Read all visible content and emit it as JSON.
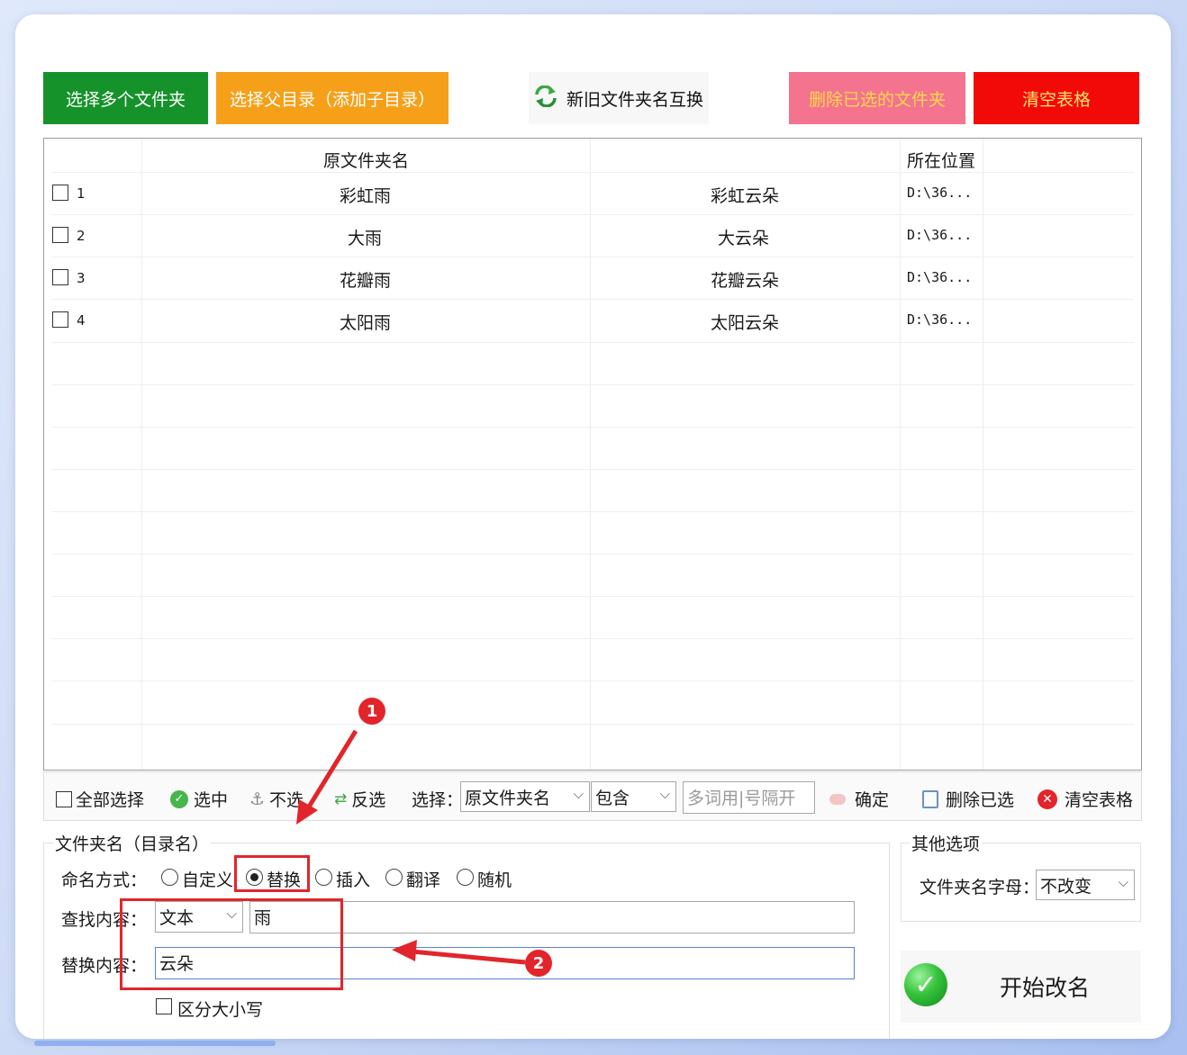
{
  "toolbar_top": {
    "select_multiple": "选择多个文件夹",
    "select_parent": "选择父目录（添加子目录）",
    "swap": "新旧文件夹名互换",
    "delete_selected": "删除已选的文件夹",
    "clear_table": "清空表格"
  },
  "table": {
    "headers": [
      "原文件夹名",
      "所在位置"
    ],
    "rows": [
      {
        "index": "1",
        "original": "彩虹雨",
        "new": "彩虹云朵",
        "path": "D:\\36..."
      },
      {
        "index": "2",
        "original": "大雨",
        "new": "大云朵",
        "path": "D:\\36..."
      },
      {
        "index": "3",
        "original": "花瓣雨",
        "new": "花瓣云朵",
        "path": "D:\\36..."
      },
      {
        "index": "4",
        "original": "太阳雨",
        "new": "太阳云朵",
        "path": "D:\\36..."
      }
    ]
  },
  "selection_bar": {
    "select_all": "全部选择",
    "check": "选中",
    "uncheck": "不选",
    "invert": "反选",
    "select_label": "选择：",
    "field_value": "原文件夹名",
    "match_value": "包含",
    "keywords_placeholder": "多词用|号隔开",
    "confirm": "确定",
    "delete_selected": "删除已选",
    "clear_table": "清空表格"
  },
  "rename": {
    "group_title": "文件夹名（目录名）",
    "mode_label": "命名方式：",
    "modes": [
      "自定义",
      "替换",
      "插入",
      "翻译",
      "随机"
    ],
    "selected_mode": "替换",
    "find_label": "查找内容：",
    "find_type": "文本",
    "find_value": "雨",
    "replace_label": "替换内容：",
    "replace_value": "云朵",
    "case_sensitive": "区分大小写"
  },
  "other_options": {
    "group_title": "其他选项",
    "letter_label": "文件夹名字母：",
    "letter_value": "不改变"
  },
  "start_button": "开始改名",
  "annotations": {
    "marker1": "1",
    "marker2": "2"
  },
  "colors": {
    "annotation_red": "#e2252b",
    "green_button": "#16922b",
    "orange_button": "#f6a01a",
    "pink_button": "#f4738f",
    "red_button": "#f20a08"
  }
}
